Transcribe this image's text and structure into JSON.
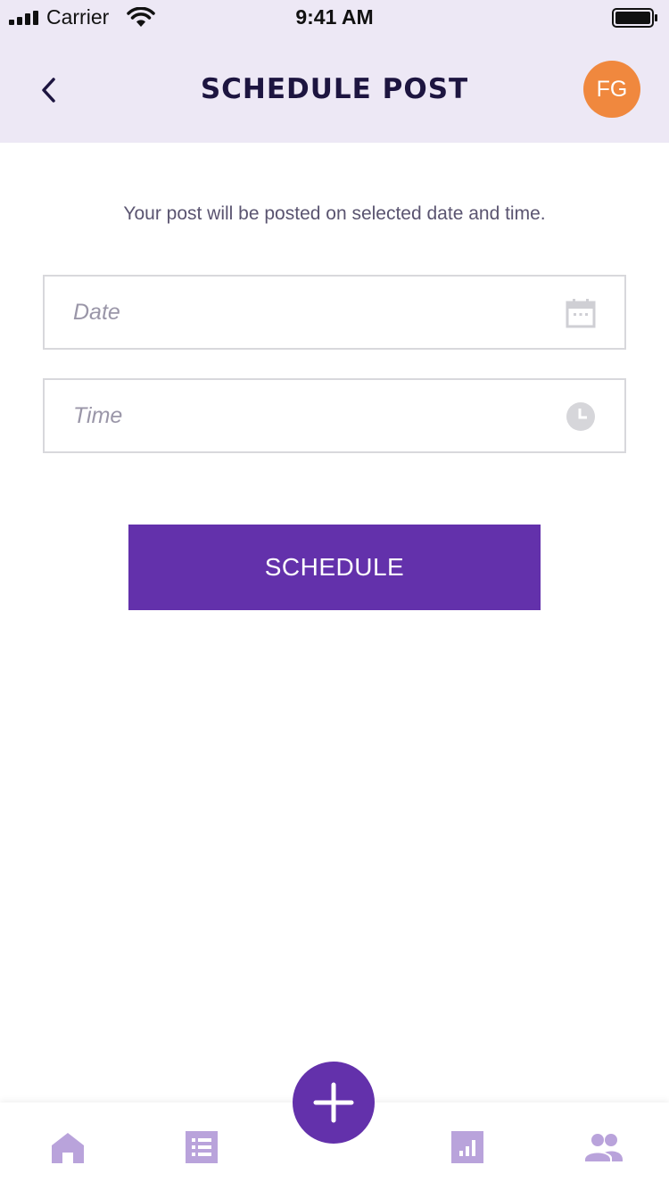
{
  "status_bar": {
    "carrier": "Carrier",
    "time": "9:41 AM"
  },
  "header": {
    "title": "SCHEDULE POST",
    "avatar_initials": "FG",
    "avatar_color": "#f0883e"
  },
  "main": {
    "info_text": "Your post will be posted on selected date and time.",
    "date_field": {
      "placeholder": "Date",
      "value": "",
      "icon": "calendar-icon"
    },
    "time_field": {
      "placeholder": "Time",
      "value": "",
      "icon": "clock-icon"
    },
    "schedule_button": "SCHEDULE"
  },
  "tab_bar": {
    "items": [
      "home-icon",
      "list-icon",
      "add-icon",
      "stats-icon",
      "people-icon"
    ]
  },
  "colors": {
    "accent": "#6331ab",
    "header_bg": "#ede8f5",
    "tab_icon": "#b9a3db"
  }
}
